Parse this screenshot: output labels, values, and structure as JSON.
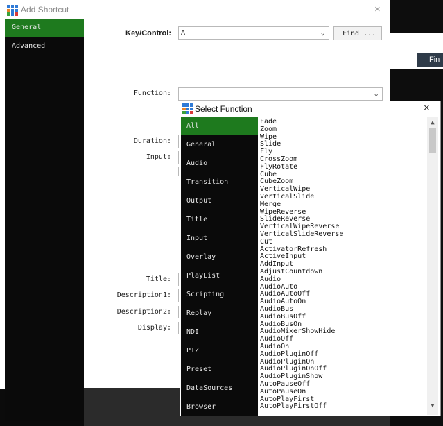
{
  "background": {
    "find_label": "Fin"
  },
  "add_shortcut": {
    "title": "Add Shortcut",
    "close": "×",
    "sidebar": [
      "General",
      "Advanced"
    ],
    "key_control_label": "Key/Control:",
    "key_control_value": "A",
    "find_button": "Find ...",
    "function_label": "Function:",
    "duration_label": "Duration:",
    "input_label": "Input:",
    "title_label": "Title:",
    "description1_label": "Description1:",
    "description2_label": "Description2:",
    "display_label": "Display:",
    "chevron": "⌄"
  },
  "select_function": {
    "title": "Select Function",
    "close": "×",
    "categories": [
      "All",
      "General",
      "Audio",
      "Transition",
      "Output",
      "Title",
      "Input",
      "Overlay",
      "PlayList",
      "Scripting",
      "Replay",
      "NDI",
      "PTZ",
      "Preset",
      "DataSources",
      "Browser"
    ],
    "functions": [
      "Fade",
      "Zoom",
      "Wipe",
      "Slide",
      "Fly",
      "CrossZoom",
      "FlyRotate",
      "Cube",
      "CubeZoom",
      "VerticalWipe",
      "VerticalSlide",
      "Merge",
      "WipeReverse",
      "SlideReverse",
      "VerticalWipeReverse",
      "VerticalSlideReverse",
      "Cut",
      "ActivatorRefresh",
      "ActiveInput",
      "AddInput",
      "AdjustCountdown",
      "Audio",
      "AudioAuto",
      "AudioAutoOff",
      "AudioAutoOn",
      "AudioBus",
      "AudioBusOff",
      "AudioBusOn",
      "AudioMixerShowHide",
      "AudioOff",
      "AudioOn",
      "AudioPluginOff",
      "AudioPluginOn",
      "AudioPluginOnOff",
      "AudioPluginShow",
      "AutoPauseOff",
      "AutoPauseOn",
      "AutoPlayFirst",
      "AutoPlayFirstOff"
    ],
    "scroll_up": "▲",
    "scroll_down": "▼"
  },
  "colors": {
    "accent_green": "#1e7a1e",
    "dark_panel": "#0a0a0a"
  },
  "icons": {
    "app": "vmix-grid-icon"
  }
}
